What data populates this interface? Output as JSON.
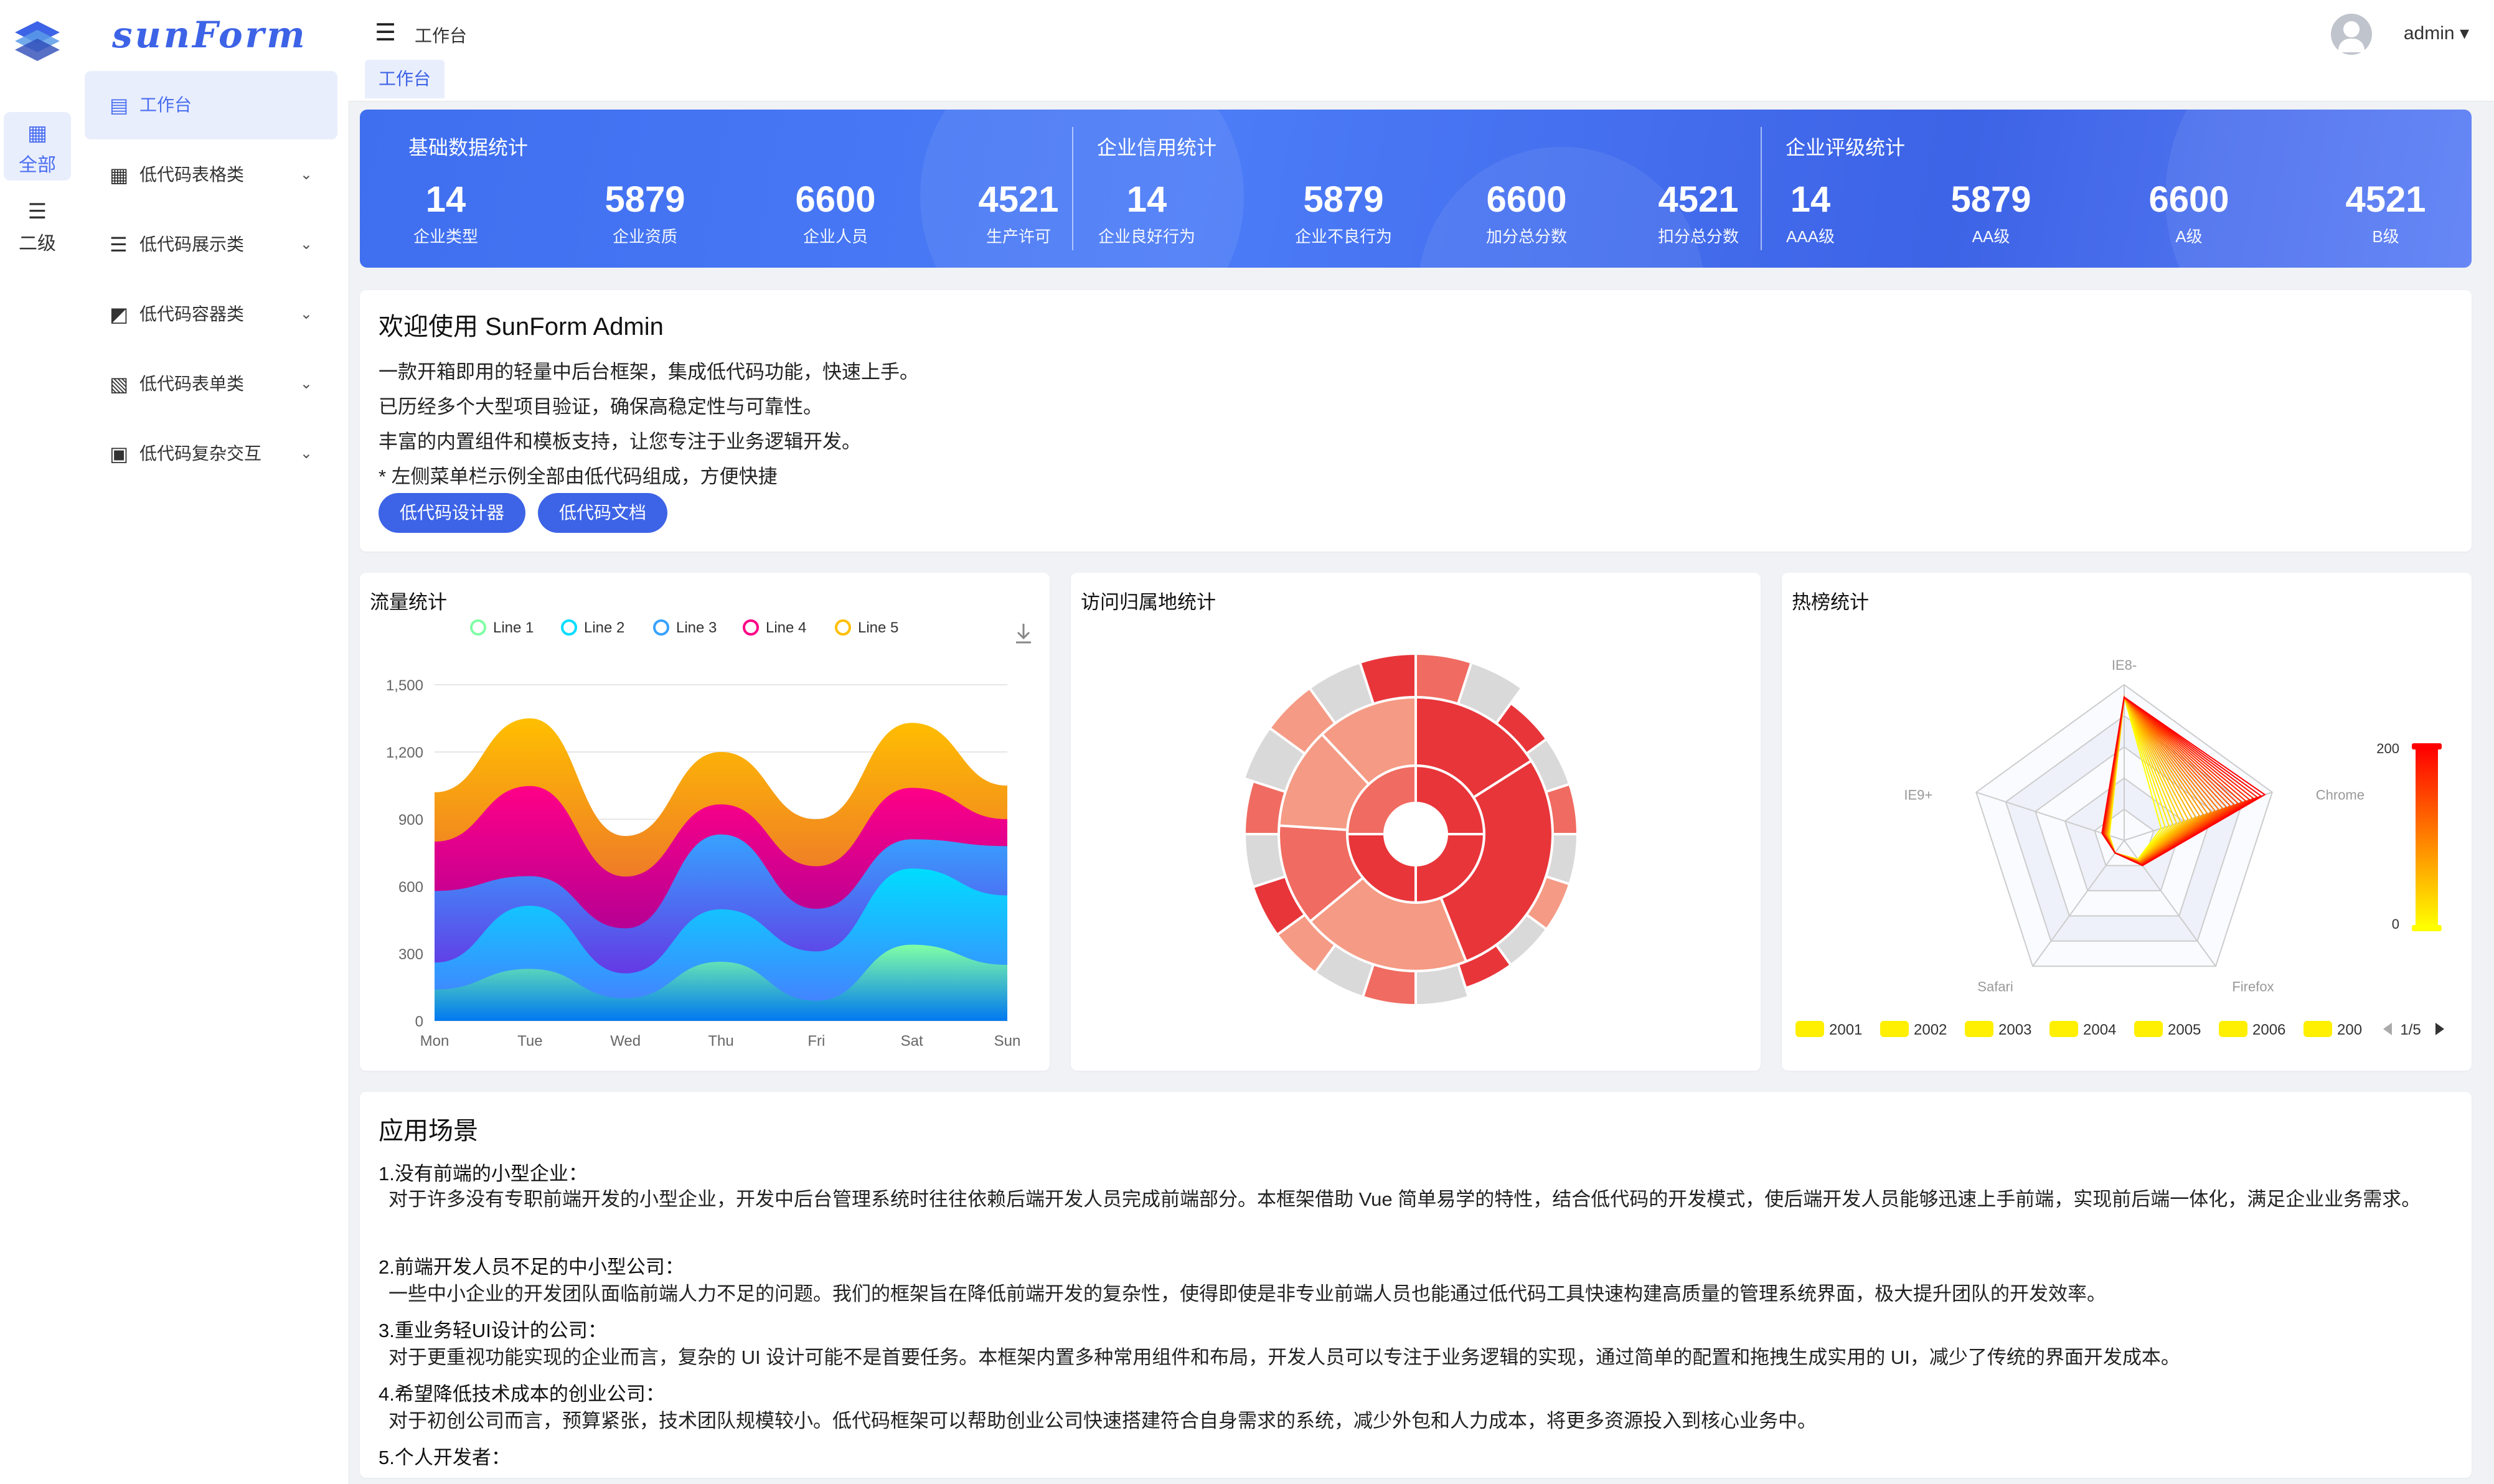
{
  "brand": "sunForm",
  "rail": {
    "items": [
      {
        "label": "全部"
      },
      {
        "label": "二级"
      }
    ]
  },
  "menu": {
    "items": [
      {
        "label": "工作台",
        "icon": "dashboard-icon"
      },
      {
        "label": "低代码表格类",
        "icon": "calendar-table-icon"
      },
      {
        "label": "低代码展示类",
        "icon": "stack-icon"
      },
      {
        "label": "低代码容器类",
        "icon": "line-chart-icon"
      },
      {
        "label": "低代码表单类",
        "icon": "form-doc-icon"
      },
      {
        "label": "低代码复杂交互",
        "icon": "briefcase-icon"
      }
    ]
  },
  "header": {
    "breadcrumb": "工作台",
    "tab": "工作台",
    "user": "admin"
  },
  "banner": {
    "groups": [
      {
        "title": "基础数据统计",
        "stats": [
          {
            "value": "14",
            "label": "企业类型"
          },
          {
            "value": "5879",
            "label": "企业资质"
          },
          {
            "value": "6600",
            "label": "企业人员"
          },
          {
            "value": "4521",
            "label": "生产许可"
          }
        ]
      },
      {
        "title": "企业信用统计",
        "stats": [
          {
            "value": "14",
            "label": "企业良好行为"
          },
          {
            "value": "5879",
            "label": "企业不良行为"
          },
          {
            "value": "6600",
            "label": "加分总分数"
          },
          {
            "value": "4521",
            "label": "扣分总分数"
          }
        ]
      },
      {
        "title": "企业评级统计",
        "stats": [
          {
            "value": "14",
            "label": "AAA级"
          },
          {
            "value": "5879",
            "label": "AA级"
          },
          {
            "value": "6600",
            "label": "A级"
          },
          {
            "value": "4521",
            "label": "B级"
          }
        ]
      }
    ]
  },
  "welcome": {
    "title": "欢迎使用 SunForm Admin",
    "lines": [
      "一款开箱即用的轻量中后台框架，集成低代码功能，快速上手。",
      "已历经多个大型项目验证，确保高稳定性与可靠性。",
      "丰富的内置组件和模板支持，让您专注于业务逻辑开发。",
      "* 左侧菜单栏示例全部由低代码组成，方便快捷"
    ],
    "buttons": [
      "低代码设计器",
      "低代码文档"
    ]
  },
  "charts": {
    "traffic_title": "流量统计",
    "region_title": "访问归属地统计",
    "hot_title": "热榜统计"
  },
  "chart_data": [
    {
      "type": "area",
      "title": "流量统计",
      "categories": [
        "Mon",
        "Tue",
        "Wed",
        "Thu",
        "Fri",
        "Sat",
        "Sun"
      ],
      "stacked": true,
      "smooth": true,
      "ylim": [
        0,
        1500
      ],
      "yticks": [
        "0",
        "300",
        "600",
        "900",
        "1,200",
        "1,500"
      ],
      "legend_position": "top",
      "series": [
        {
          "name": "Line 1",
          "color": "#80FFA5",
          "values": [
            140,
            232,
            101,
            264,
            90,
            340,
            250
          ]
        },
        {
          "name": "Line 2",
          "color": "#00DDFF",
          "values": [
            120,
            282,
            111,
            234,
            220,
            340,
            310
          ]
        },
        {
          "name": "Line 3",
          "color": "#37A2FF",
          "values": [
            320,
            132,
            201,
            334,
            190,
            130,
            220
          ]
        },
        {
          "name": "Line 4",
          "color": "#FF0087",
          "values": [
            220,
            402,
            231,
            134,
            190,
            230,
            120
          ]
        },
        {
          "name": "Line 5",
          "color": "#FFBF00",
          "values": [
            220,
            302,
            181,
            234,
            210,
            290,
            150
          ]
        }
      ]
    },
    {
      "type": "sunburst",
      "title": "访问归属地统计",
      "rings": [
        [
          {
            "value": 3,
            "color": "#e8353a"
          },
          {
            "value": 3,
            "color": "#e8353a"
          },
          {
            "value": 3,
            "color": "#e8353a"
          },
          {
            "value": 3,
            "color": "#f06b61"
          }
        ],
        [
          {
            "value": 2,
            "color": "#e8353a"
          },
          {
            "value": 3.5,
            "color": "#e8353a"
          },
          {
            "value": 2.5,
            "color": "#f59a84"
          },
          {
            "value": 1.5,
            "color": "#f06b61"
          },
          {
            "value": 1.5,
            "color": "#f59a84"
          },
          {
            "value": 1.5,
            "color": "#f59a84"
          }
        ],
        [
          {
            "value": 1,
            "color": "#f06b61"
          },
          {
            "value": 1,
            "color": "#d9d9d9"
          },
          {
            "value": 1,
            "color": "#e8353a"
          },
          {
            "value": 1,
            "color": "#d9d9d9"
          },
          {
            "value": 1,
            "color": "#f06b61"
          },
          {
            "value": 1,
            "color": "#d9d9d9"
          },
          {
            "value": 1,
            "color": "#f59a84"
          },
          {
            "value": 1,
            "color": "#d9d9d9"
          },
          {
            "value": 1,
            "color": "#e8353a"
          },
          {
            "value": 1,
            "color": "#d9d9d9"
          },
          {
            "value": 1,
            "color": "#f06b61"
          },
          {
            "value": 1,
            "color": "#d9d9d9"
          },
          {
            "value": 1,
            "color": "#f59a84"
          },
          {
            "value": 1,
            "color": "#e8353a"
          },
          {
            "value": 1,
            "color": "#d9d9d9"
          },
          {
            "value": 1,
            "color": "#f06b61"
          },
          {
            "value": 1,
            "color": "#d9d9d9"
          },
          {
            "value": 1,
            "color": "#f59a84"
          },
          {
            "value": 1,
            "color": "#d9d9d9"
          },
          {
            "value": 1,
            "color": "#e8353a"
          }
        ]
      ]
    },
    {
      "type": "radar",
      "title": "热榜统计",
      "indicators": [
        "IE8-",
        "Chrome",
        "Firefox",
        "Safari",
        "IE9+"
      ],
      "legend": [
        "2001",
        "2002",
        "2003",
        "2004",
        "2005",
        "2006",
        "200"
      ],
      "pager": "1/5",
      "visual_map": {
        "min": "0",
        "max": "200",
        "colors": [
          "#ffff00",
          "#ff0000"
        ]
      },
      "series_count": 28
    }
  ],
  "apps": {
    "title": "应用场景",
    "items": [
      {
        "t": "1.没有前端的小型企业：",
        "d": "对于许多没有专职前端开发的小型企业，开发中后台管理系统时往往依赖后端开发人员完成前端部分。本框架借助 Vue 简单易学的特性，结合低代码的开发模式，使后端开发人员能够迅速上手前端，实现前后端一体化，满足企业业务需求。"
      },
      {
        "t": "2.前端开发人员不足的中小型公司：",
        "d": "一些中小企业的开发团队面临前端人力不足的问题。我们的框架旨在降低前端开发的复杂性，使得即使是非专业前端人员也能通过低代码工具快速构建高质量的管理系统界面，极大提升团队的开发效率。"
      },
      {
        "t": "3.重业务轻UI设计的公司：",
        "d": "对于更重视功能实现的企业而言，复杂的 UI 设计可能不是首要任务。本框架内置多种常用组件和布局，开发人员可以专注于业务逻辑的实现，通过简单的配置和拖拽生成实用的 UI，减少了传统的界面开发成本。"
      },
      {
        "t": "4.希望降低技术成本的创业公司：",
        "d": "对于初创公司而言，预算紧张，技术团队规模较小。低代码框架可以帮助创业公司快速搭建符合自身需求的系统，减少外包和人力成本，将更多资源投入到核心业务中。"
      },
      {
        "t": "5.个人开发者：",
        "d": ""
      }
    ]
  },
  "colors": {
    "primary": "#3d63e6",
    "active_bg": "#e9eefc"
  }
}
